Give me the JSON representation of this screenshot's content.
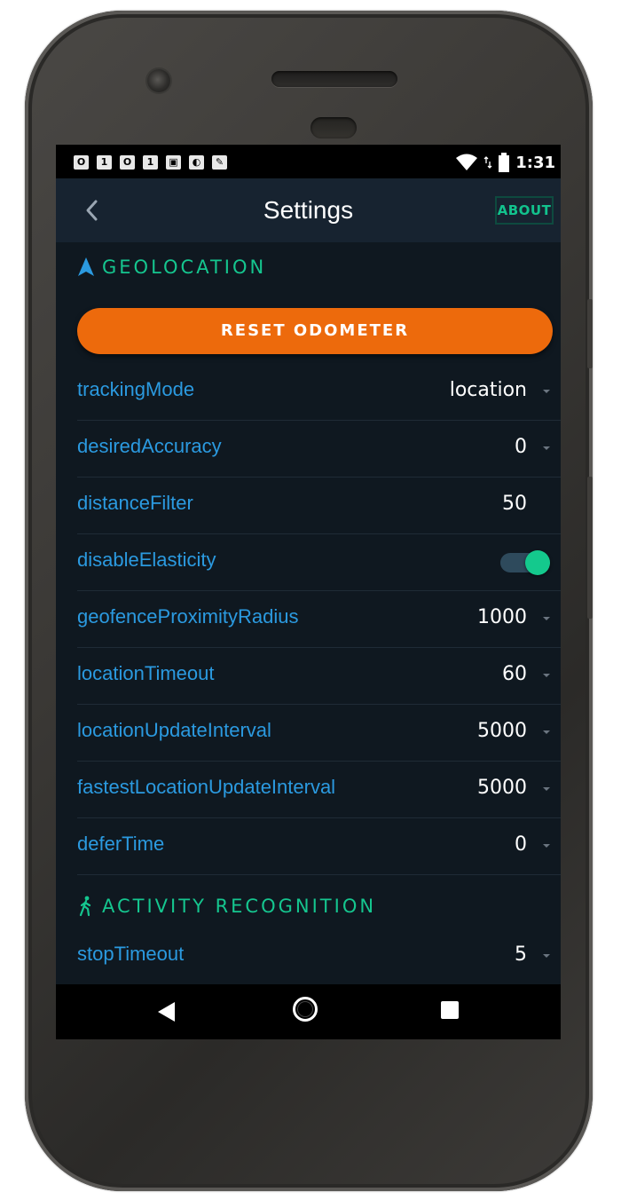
{
  "statusbar": {
    "notifications": [
      "O",
      "1",
      "O",
      "1",
      "▣",
      "◐",
      "✎"
    ],
    "time": "1:31"
  },
  "appbar": {
    "title": "Settings",
    "about_label": "ABOUT"
  },
  "sections": {
    "geolocation": {
      "title": "GEOLOCATION",
      "icon": "navigation-arrow-icon",
      "reset_button_label": "RESET ODOMETER",
      "rows": [
        {
          "label": "trackingMode",
          "value": "location",
          "control": "dropdown"
        },
        {
          "label": "desiredAccuracy",
          "value": "0",
          "control": "dropdown"
        },
        {
          "label": "distanceFilter",
          "value": "50",
          "control": "text"
        },
        {
          "label": "disableElasticity",
          "value": "on",
          "control": "toggle"
        },
        {
          "label": "geofenceProximityRadius",
          "value": "1000",
          "control": "dropdown"
        },
        {
          "label": "locationTimeout",
          "value": "60",
          "control": "dropdown"
        },
        {
          "label": "locationUpdateInterval",
          "value": "5000",
          "control": "dropdown"
        },
        {
          "label": "fastestLocationUpdateInterval",
          "value": "5000",
          "control": "dropdown"
        },
        {
          "label": "deferTime",
          "value": "0",
          "control": "dropdown"
        }
      ]
    },
    "activity": {
      "title": "ACTIVITY RECOGNITION",
      "icon": "walking-person-icon",
      "rows": [
        {
          "label": "stopTimeout",
          "value": "5",
          "control": "dropdown"
        }
      ]
    }
  },
  "colors": {
    "accent_green": "#15c68f",
    "label_blue": "#2b9ae0",
    "button_orange": "#ed6a0c",
    "background": "#0f1820"
  }
}
